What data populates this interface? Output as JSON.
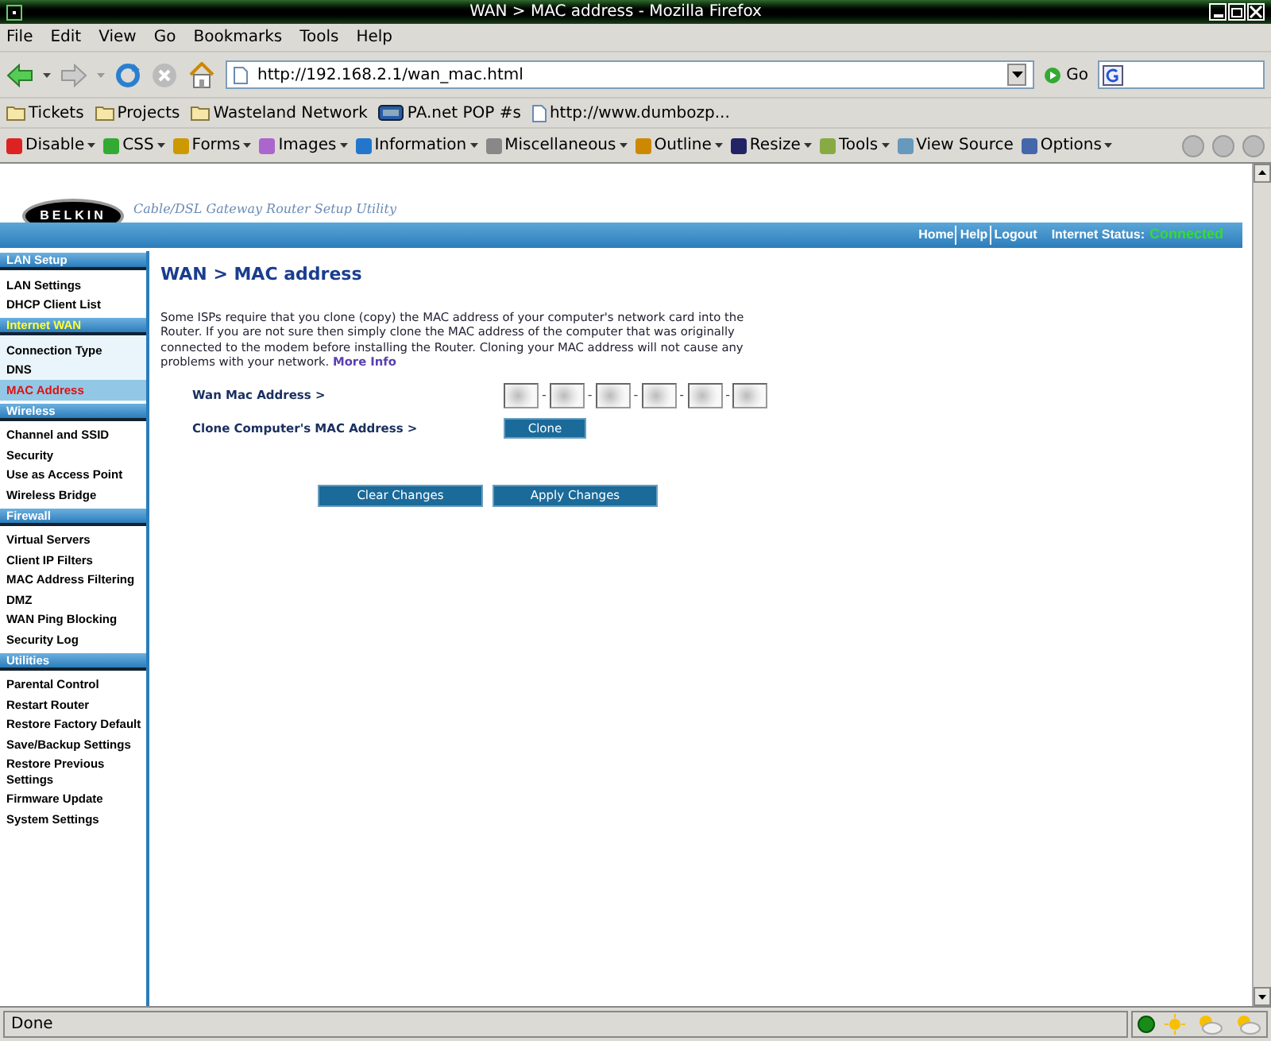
{
  "window": {
    "title": "WAN > MAC address - Mozilla Firefox"
  },
  "menu": [
    "File",
    "Edit",
    "View",
    "Go",
    "Bookmarks",
    "Tools",
    "Help"
  ],
  "navigation": {
    "url": "http://192.168.2.1/wan_mac.html",
    "go_label": "Go"
  },
  "bookmarks": [
    {
      "kind": "folder",
      "label": "Tickets"
    },
    {
      "kind": "folder",
      "label": "Projects"
    },
    {
      "kind": "folder",
      "label": "Wasteland Network"
    },
    {
      "kind": "site",
      "label": "PA.net POP #s"
    },
    {
      "kind": "page",
      "label": "http://www.dumbozp..."
    }
  ],
  "dev_toolbar": [
    "Disable",
    "CSS",
    "Forms",
    "Images",
    "Information",
    "Miscellaneous",
    "Outline",
    "Resize",
    "Tools",
    "View Source",
    "Options"
  ],
  "page": {
    "logo": "BELKIN",
    "subtitle": "Cable/DSL Gateway Router Setup Utility",
    "header_links": [
      "Home",
      "Help",
      "Logout"
    ],
    "status_label": "Internet Status:",
    "status_value": "Connected",
    "sidebar": [
      {
        "title": "LAN Setup",
        "selected": false,
        "items": [
          {
            "label": "LAN Settings",
            "selected": false
          },
          {
            "label": "DHCP Client List",
            "selected": false
          }
        ]
      },
      {
        "title": "Internet WAN",
        "selected": true,
        "items": [
          {
            "label": "Connection Type",
            "selected": false
          },
          {
            "label": "DNS",
            "selected": false
          },
          {
            "label": "MAC Address",
            "selected": true
          }
        ]
      },
      {
        "title": "Wireless",
        "selected": false,
        "items": [
          {
            "label": "Channel and SSID",
            "selected": false
          },
          {
            "label": "Security",
            "selected": false
          },
          {
            "label": "Use as Access Point",
            "selected": false
          },
          {
            "label": "Wireless Bridge",
            "selected": false
          }
        ]
      },
      {
        "title": "Firewall",
        "selected": false,
        "items": [
          {
            "label": "Virtual Servers",
            "selected": false
          },
          {
            "label": "Client IP Filters",
            "selected": false
          },
          {
            "label": "MAC Address Filtering",
            "selected": false
          },
          {
            "label": "DMZ",
            "selected": false
          },
          {
            "label": "WAN Ping Blocking",
            "selected": false
          },
          {
            "label": "Security Log",
            "selected": false
          }
        ]
      },
      {
        "title": "Utilities",
        "selected": false,
        "items": [
          {
            "label": "Parental Control",
            "selected": false
          },
          {
            "label": "Restart Router",
            "selected": false
          },
          {
            "label": "Restore Factory Default",
            "selected": false
          },
          {
            "label": "Save/Backup Settings",
            "selected": false
          },
          {
            "label": "Restore Previous Settings",
            "selected": false
          },
          {
            "label": "Firmware Update",
            "selected": false
          },
          {
            "label": "System Settings",
            "selected": false
          }
        ]
      }
    ],
    "heading": "WAN > MAC address",
    "intro": "Some ISPs require that you clone (copy) the MAC address of your computer's network card into the Router. If you are not sure then simply clone the MAC address of the computer that was originally connected to the modem before installing the Router. Cloning your MAC address will not cause any problems with your network.",
    "more_info": "More Info",
    "mac_label": "Wan Mac Address >",
    "mac_separator": "-",
    "mac_fields": [
      {
        "kind": "blurred"
      },
      {
        "kind": "blurred"
      },
      {
        "kind": "blurred"
      },
      {
        "kind": "blurred"
      },
      {
        "kind": "blurred"
      },
      {
        "kind": "blurred"
      }
    ],
    "clone_label": "Clone Computer's MAC Address >",
    "clone_button": "Clone",
    "buttons": [
      "Clear Changes",
      "Apply Changes"
    ]
  },
  "status_bar": {
    "text": "Done"
  }
}
